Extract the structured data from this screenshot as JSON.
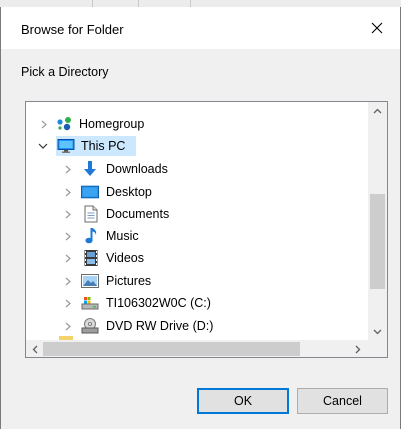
{
  "window": {
    "title": "Browse for Folder"
  },
  "prompt": "Pick a Directory",
  "tree": {
    "items": [
      {
        "label": "Homegroup",
        "icon": "homegroup-icon",
        "level": 0,
        "expanded": false,
        "selected": false
      },
      {
        "label": "This PC",
        "icon": "pc-icon",
        "level": 0,
        "expanded": true,
        "selected": true
      },
      {
        "label": "Downloads",
        "icon": "downloads-icon",
        "level": 1,
        "expanded": false,
        "selected": false
      },
      {
        "label": "Desktop",
        "icon": "desktop-icon",
        "level": 1,
        "expanded": false,
        "selected": false
      },
      {
        "label": "Documents",
        "icon": "documents-icon",
        "level": 1,
        "expanded": false,
        "selected": false
      },
      {
        "label": "Music",
        "icon": "music-icon",
        "level": 1,
        "expanded": false,
        "selected": false
      },
      {
        "label": "Videos",
        "icon": "videos-icon",
        "level": 1,
        "expanded": false,
        "selected": false
      },
      {
        "label": "Pictures",
        "icon": "pictures-icon",
        "level": 1,
        "expanded": false,
        "selected": false
      },
      {
        "label": "TI106302W0C (C:)",
        "icon": "drive-icon",
        "level": 1,
        "expanded": false,
        "selected": false
      },
      {
        "label": "DVD RW Drive (D:)",
        "icon": "dvd-drive-icon",
        "level": 1,
        "expanded": false,
        "selected": false
      }
    ]
  },
  "buttons": {
    "ok": "OK",
    "cancel": "Cancel"
  },
  "colors": {
    "selection": "#cce8ff",
    "accent": "#0078d7",
    "dialog_bg": "#f0f0f0"
  }
}
